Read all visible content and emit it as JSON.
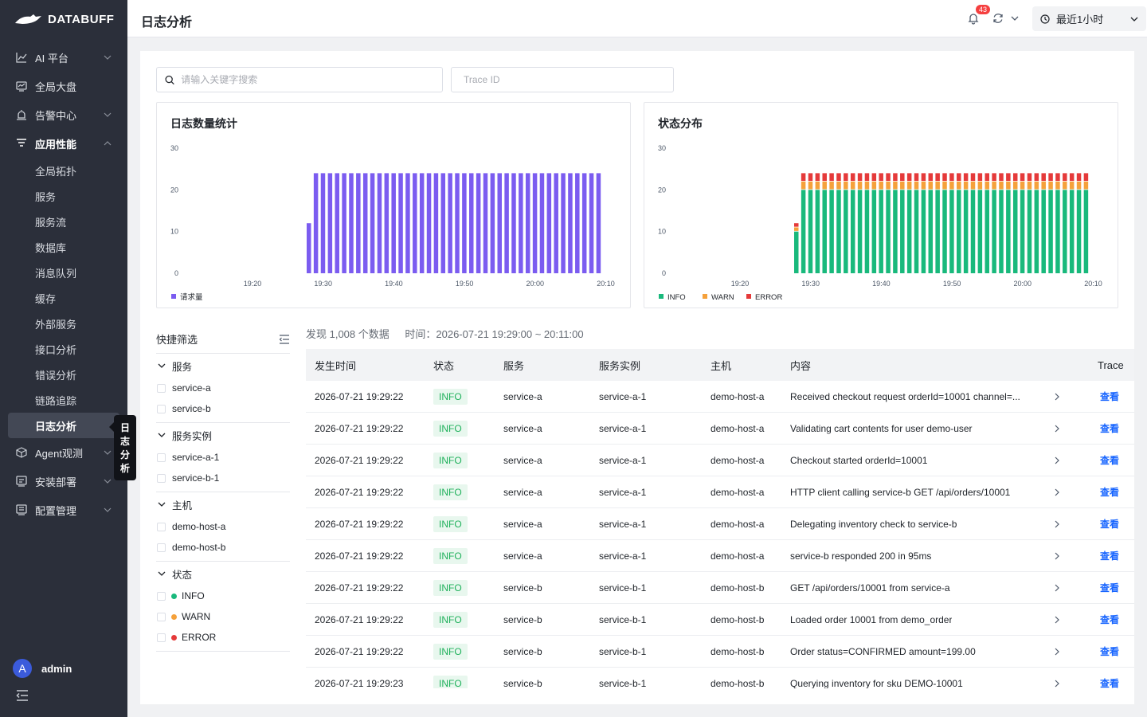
{
  "app": {
    "brand": "DATABUFF",
    "page_title": "日志分析"
  },
  "sidebar": {
    "items": [
      {
        "label": "AI 平台",
        "icon": "chart-icon",
        "expandable": true
      },
      {
        "label": "全局大盘",
        "icon": "dashboard-icon",
        "expandable": false
      },
      {
        "label": "告警中心",
        "icon": "alarm-icon",
        "expandable": true
      },
      {
        "label": "应用性能",
        "icon": "list-icon",
        "expandable": true,
        "expanded": true
      }
    ],
    "sub_items": [
      "全局拓扑",
      "服务",
      "服务流",
      "数据库",
      "消息队列",
      "缓存",
      "外部服务",
      "接口分析",
      "错误分析",
      "链路追踪",
      "日志分析"
    ],
    "active_sub": "日志分析",
    "items_after": [
      {
        "label": "Agent观测",
        "icon": "cube-icon"
      },
      {
        "label": "安装部署",
        "icon": "install-icon"
      },
      {
        "label": "配置管理",
        "icon": "config-icon"
      }
    ],
    "tooltip": "日志分析",
    "user": {
      "initial": "A",
      "name": "admin"
    }
  },
  "topbar": {
    "notification_count": "43",
    "time_range": "最近1小时"
  },
  "search": {
    "placeholder": "请输入关键字搜索",
    "trace_placeholder": "Trace ID"
  },
  "chart_data": [
    {
      "type": "bar",
      "title": "日志数量统计",
      "ylim": [
        0,
        30
      ],
      "yticks": [
        0,
        10,
        20,
        30
      ],
      "xticks": [
        "19:20",
        "19:30",
        "19:40",
        "19:50",
        "20:00",
        "20:10"
      ],
      "series": [
        {
          "name": "请求量",
          "color": "#7b5cf0",
          "values": [
            12,
            24,
            24,
            24,
            24,
            24,
            24,
            24,
            24,
            24,
            24,
            24,
            24,
            24,
            24,
            24,
            24,
            24,
            24,
            24,
            24,
            24,
            24,
            24,
            24,
            24,
            24,
            24,
            24,
            24,
            24,
            24,
            24,
            24,
            24,
            24,
            24,
            24,
            24,
            24,
            24,
            24
          ]
        }
      ]
    },
    {
      "type": "bar",
      "stacked": true,
      "title": "状态分布",
      "ylim": [
        0,
        30
      ],
      "yticks": [
        0,
        10,
        20,
        30
      ],
      "xticks": [
        "19:20",
        "19:30",
        "19:40",
        "19:50",
        "20:00",
        "20:10"
      ],
      "series": [
        {
          "name": "INFO",
          "color": "#19b97c",
          "values": [
            10,
            20,
            20,
            20,
            20,
            20,
            20,
            20,
            20,
            20,
            20,
            20,
            20,
            20,
            20,
            20,
            20,
            20,
            20,
            20,
            20,
            20,
            20,
            20,
            20,
            20,
            20,
            20,
            20,
            20,
            20,
            20,
            20,
            20,
            20,
            20,
            20,
            20,
            20,
            20,
            20,
            20
          ]
        },
        {
          "name": "WARN",
          "color": "#f5a13b",
          "values": [
            1,
            2,
            2,
            2,
            2,
            2,
            2,
            2,
            2,
            2,
            2,
            2,
            2,
            2,
            2,
            2,
            2,
            2,
            2,
            2,
            2,
            2,
            2,
            2,
            2,
            2,
            2,
            2,
            2,
            2,
            2,
            2,
            2,
            2,
            2,
            2,
            2,
            2,
            2,
            2,
            2,
            2
          ]
        },
        {
          "name": "ERROR",
          "color": "#e53a3a",
          "values": [
            1,
            2,
            2,
            2,
            2,
            2,
            2,
            2,
            2,
            2,
            2,
            2,
            2,
            2,
            2,
            2,
            2,
            2,
            2,
            2,
            2,
            2,
            2,
            2,
            2,
            2,
            2,
            2,
            2,
            2,
            2,
            2,
            2,
            2,
            2,
            2,
            2,
            2,
            2,
            2,
            2,
            2
          ]
        }
      ]
    }
  ],
  "quick_filter": {
    "title": "快捷筛选",
    "groups": [
      {
        "title": "服务",
        "options": [
          "service-a",
          "service-b"
        ]
      },
      {
        "title": "服务实例",
        "options": [
          "service-a-1",
          "service-b-1"
        ]
      },
      {
        "title": "主机",
        "options": [
          "demo-host-a",
          "demo-host-b"
        ]
      },
      {
        "title": "状态",
        "options": [
          "INFO",
          "WARN",
          "ERROR"
        ],
        "colors": [
          "#19b97c",
          "#f5a13b",
          "#e53a3a"
        ]
      }
    ]
  },
  "summary": {
    "count": "发现 1,008 个数据",
    "time": "时间：2026-07-21 19:29:00 ~ 20:11:00"
  },
  "table": {
    "headers": [
      "发生时间",
      "状态",
      "服务",
      "服务实例",
      "主机",
      "内容",
      "Trace"
    ],
    "view_label": "查看",
    "rows": [
      [
        "2026-07-21 19:29:22",
        "INFO",
        "service-a",
        "service-a-1",
        "demo-host-a",
        "Received checkout request orderId=10001 channel=..."
      ],
      [
        "2026-07-21 19:29:22",
        "INFO",
        "service-a",
        "service-a-1",
        "demo-host-a",
        "Validating cart contents for user demo-user"
      ],
      [
        "2026-07-21 19:29:22",
        "INFO",
        "service-a",
        "service-a-1",
        "demo-host-a",
        "Checkout started orderId=10001"
      ],
      [
        "2026-07-21 19:29:22",
        "INFO",
        "service-a",
        "service-a-1",
        "demo-host-a",
        "HTTP client calling service-b GET /api/orders/10001"
      ],
      [
        "2026-07-21 19:29:22",
        "INFO",
        "service-a",
        "service-a-1",
        "demo-host-a",
        "Delegating inventory check to service-b"
      ],
      [
        "2026-07-21 19:29:22",
        "INFO",
        "service-a",
        "service-a-1",
        "demo-host-a",
        "service-b responded 200 in 95ms"
      ],
      [
        "2026-07-21 19:29:22",
        "INFO",
        "service-b",
        "service-b-1",
        "demo-host-b",
        "GET /api/orders/10001 from service-a"
      ],
      [
        "2026-07-21 19:29:22",
        "INFO",
        "service-b",
        "service-b-1",
        "demo-host-b",
        "Loaded order 10001 from demo_order"
      ],
      [
        "2026-07-21 19:29:22",
        "INFO",
        "service-b",
        "service-b-1",
        "demo-host-b",
        "Order status=CONFIRMED amount=199.00"
      ],
      [
        "2026-07-21 19:29:23",
        "INFO",
        "service-b",
        "service-b-1",
        "demo-host-b",
        "Querying inventory for sku DEMO-10001"
      ]
    ]
  }
}
